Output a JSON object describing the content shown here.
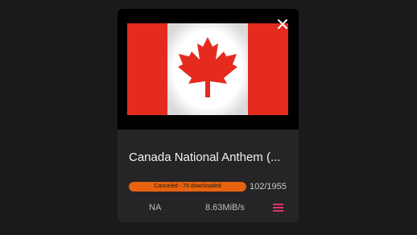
{
  "card": {
    "title": "Canada National Anthem (...",
    "progress": {
      "status_text": "Canceled - 79 downloaded",
      "count": "102/1955",
      "fraction": 1.0
    },
    "eta": "NA",
    "speed": "8.63MiB/s"
  },
  "colors": {
    "background": "#1a1a1a",
    "card": "#252528",
    "progress_fill": "#e8620f",
    "menu_icon": "#e0306b",
    "flag_red": "#e52b1e"
  },
  "icons": {
    "close": "close-icon",
    "menu": "menu-icon",
    "thumbnail": "canada-flag"
  }
}
